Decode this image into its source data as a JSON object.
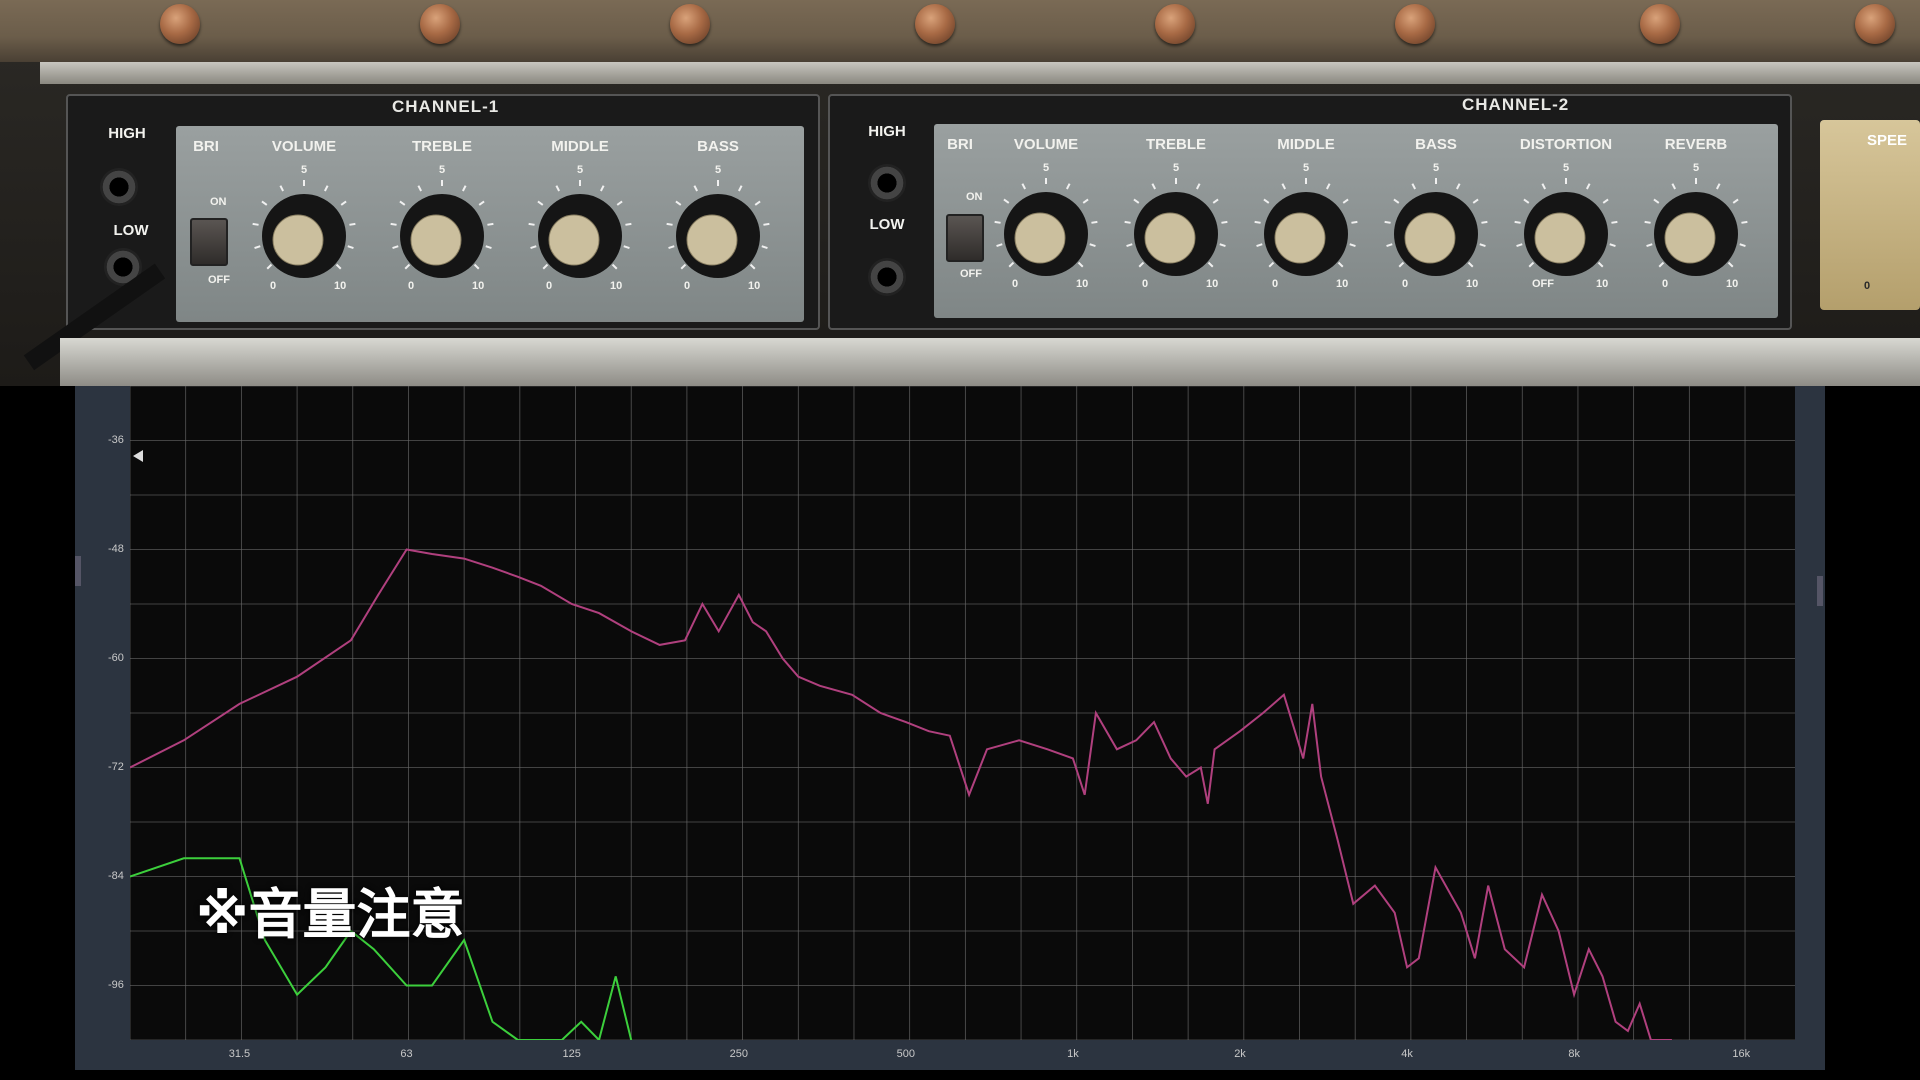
{
  "amp": {
    "channel1": {
      "title": "CHANNEL-1",
      "inputs": [
        "HIGH",
        "LOW"
      ],
      "bright_label": "BRI",
      "switch_on": "ON",
      "switch_off": "OFF",
      "knobs": [
        {
          "label": "VOLUME",
          "min": "0",
          "max": "10",
          "mid": "5"
        },
        {
          "label": "TREBLE",
          "min": "0",
          "max": "10",
          "mid": "5"
        },
        {
          "label": "MIDDLE",
          "min": "0",
          "max": "10",
          "mid": "5"
        },
        {
          "label": "BASS",
          "min": "0",
          "max": "10",
          "mid": "5"
        }
      ]
    },
    "channel2": {
      "title": "CHANNEL-2",
      "inputs": [
        "HIGH",
        "LOW"
      ],
      "bright_label": "BRI",
      "switch_on": "ON",
      "switch_off": "OFF",
      "knobs": [
        {
          "label": "VOLUME",
          "min": "0",
          "max": "10",
          "mid": "5"
        },
        {
          "label": "TREBLE",
          "min": "0",
          "max": "10",
          "mid": "5"
        },
        {
          "label": "MIDDLE",
          "min": "0",
          "max": "10",
          "mid": "5"
        },
        {
          "label": "BASS",
          "min": "0",
          "max": "10",
          "mid": "5"
        },
        {
          "label": "DISTORTION",
          "min": "OFF",
          "max": "10",
          "mid": "5"
        },
        {
          "label": "REVERB",
          "min": "0",
          "max": "10",
          "mid": "5"
        }
      ]
    },
    "speed_label": "SPEE",
    "speed_min": "0"
  },
  "warning_text": "※音量注意",
  "colors": {
    "primary_trace": "#b0407e",
    "secondary_trace": "#3ccf3c",
    "grid": "#6a6a6a"
  },
  "chart_data": {
    "type": "line",
    "title": "",
    "xlabel": "",
    "ylabel": "",
    "x_scale": "log",
    "xlim": [
      20,
      20000
    ],
    "ylim": [
      -102,
      -30
    ],
    "x_ticks": [
      31.5,
      63,
      125,
      250,
      500,
      1000,
      2000,
      4000,
      8000,
      16000
    ],
    "x_tick_labels": [
      "31.5",
      "63",
      "125",
      "250",
      "500",
      "1k",
      "2k",
      "4k",
      "8k",
      "16k"
    ],
    "y_ticks": [
      -36,
      -48,
      -60,
      -72,
      -84,
      -96
    ],
    "y_tick_labels": [
      "-36",
      "-48",
      "-60",
      "-72",
      "-84",
      "-96"
    ],
    "grid": true,
    "series": [
      {
        "color": "#b0407e",
        "x": [
          20,
          25,
          31.5,
          40,
          50,
          56,
          63,
          70,
          80,
          90,
          100,
          110,
          125,
          140,
          160,
          180,
          200,
          215,
          230,
          250,
          265,
          280,
          300,
          320,
          350,
          400,
          450,
          500,
          550,
          600,
          650,
          700,
          800,
          900,
          1000,
          1050,
          1100,
          1200,
          1300,
          1400,
          1500,
          1600,
          1700,
          1750,
          1800,
          2000,
          2200,
          2400,
          2600,
          2700,
          2800,
          3000,
          3200,
          3500,
          3800,
          4000,
          4200,
          4500,
          5000,
          5300,
          5600,
          6000,
          6500,
          7000,
          7500,
          8000,
          8500,
          9000,
          9500,
          10000,
          10500,
          11000,
          12000
        ],
        "y": [
          -72,
          -69,
          -65,
          -62,
          -58,
          -53,
          -48,
          -48.5,
          -49,
          -50,
          -51,
          -52,
          -54,
          -55,
          -57,
          -58.5,
          -58,
          -54,
          -57,
          -53,
          -56,
          -57,
          -60,
          -62,
          -63,
          -64,
          -66,
          -67,
          -68,
          -68.5,
          -75,
          -70,
          -69,
          -70,
          -71,
          -75,
          -66,
          -70,
          -69,
          -67,
          -71,
          -73,
          -72,
          -76,
          -70,
          -68,
          -66,
          -64,
          -71,
          -65,
          -73,
          -80,
          -87,
          -85,
          -88,
          -94,
          -93,
          -83,
          -88,
          -93,
          -85,
          -92,
          -94,
          -86,
          -90,
          -97,
          -92,
          -95,
          -100,
          -101,
          -98,
          -102,
          -102
        ]
      },
      {
        "color": "#3ccf3c",
        "x": [
          20,
          25,
          31.5,
          35,
          40,
          45,
          50,
          55,
          63,
          70,
          80,
          90,
          100,
          110,
          120,
          130,
          140,
          150,
          160
        ],
        "y": [
          -84,
          -82,
          -82,
          -91,
          -97,
          -94,
          -90,
          -92,
          -96,
          -96,
          -91,
          -100,
          -102,
          -102,
          -102,
          -100,
          -102,
          -95,
          -102
        ]
      }
    ]
  }
}
